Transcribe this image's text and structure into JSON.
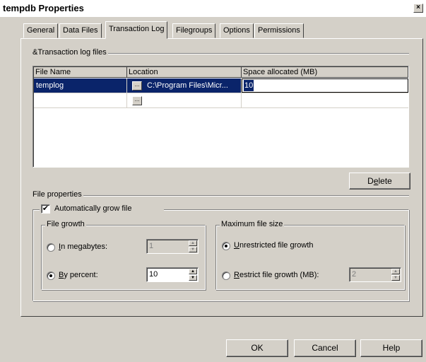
{
  "window": {
    "title": "tempdb Properties",
    "close_label": "×"
  },
  "tabs": [
    {
      "label": "General",
      "active": false
    },
    {
      "label": "Data Files",
      "active": false
    },
    {
      "label": "Transaction Log",
      "active": true
    },
    {
      "label": "Filegroups",
      "active": false
    },
    {
      "label": "Options",
      "active": false
    },
    {
      "label": "Permissions",
      "active": false
    }
  ],
  "log_files": {
    "group_label": "&Transaction log files",
    "columns": [
      "File Name",
      "Location",
      "Space allocated (MB)"
    ],
    "rows": [
      {
        "name": "templog",
        "location": "C:\\Program Files\\Micr...",
        "space": "10",
        "selected": true
      },
      {
        "name": "",
        "location": "",
        "space": "",
        "selected": false
      }
    ],
    "ellipsis_label": "..."
  },
  "delete_button": {
    "label_prefix": "D",
    "label_accel": "e",
    "label_suffix": "lete"
  },
  "file_properties": {
    "group_label": "File properties",
    "auto_grow": {
      "label_prefix": "Automatically ",
      "label_accel": "g",
      "label_suffix": "row file",
      "checked": true
    },
    "file_growth": {
      "group_label": "File growth",
      "megabytes": {
        "label_accel": "I",
        "label_suffix": "n megabytes:",
        "selected": false,
        "value": "1"
      },
      "percent": {
        "label_accel": "B",
        "label_suffix": "y percent:",
        "selected": true,
        "value": "10"
      }
    },
    "max_size": {
      "group_label": "Maximum file size",
      "unrestricted": {
        "label_accel": "U",
        "label_suffix": "nrestricted file growth",
        "selected": true
      },
      "restrict": {
        "label_accel": "R",
        "label_suffix": "estrict file growth (MB):",
        "selected": false,
        "value": "2"
      }
    }
  },
  "footer": {
    "ok": "OK",
    "cancel": "Cancel",
    "help": "Help"
  },
  "icons": {
    "checkmark": "✔",
    "up_arrow": "▲",
    "down_arrow": "▼"
  }
}
